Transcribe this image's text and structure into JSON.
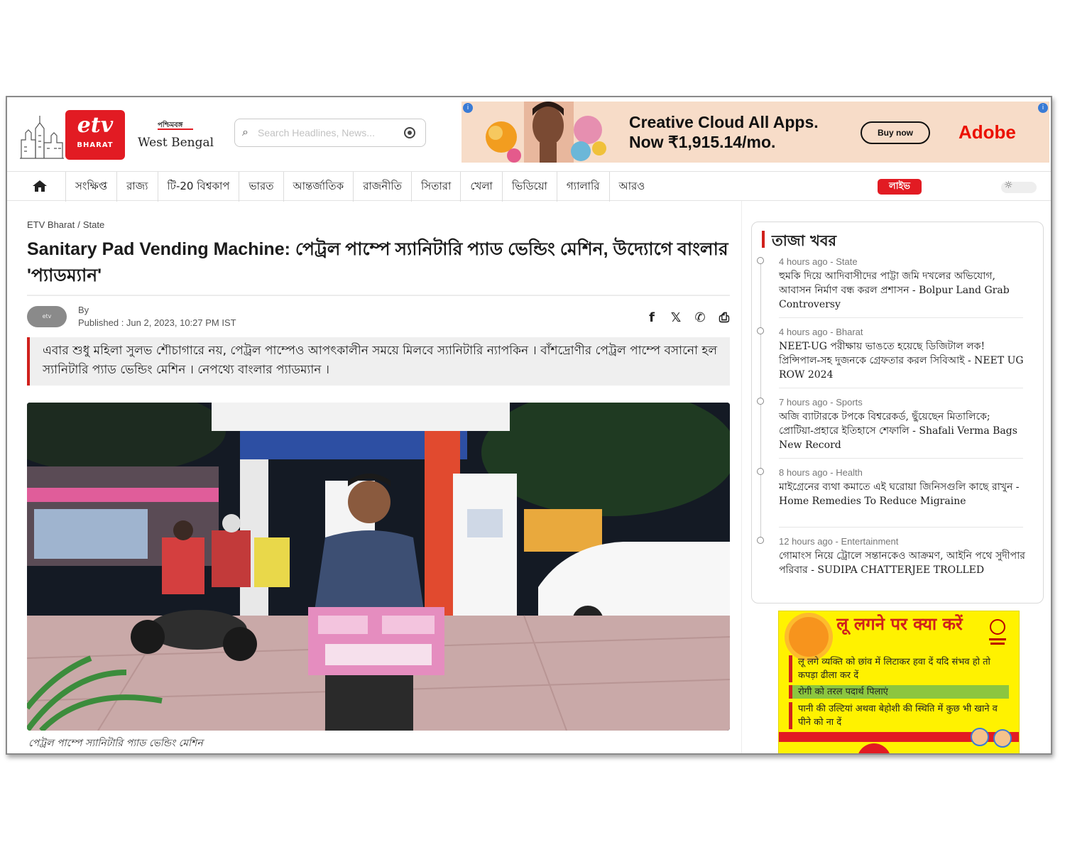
{
  "header": {
    "logo_text": "etv",
    "logo_sub": "BHARAT",
    "region_native": "পশ্চিমবঙ্গ",
    "region": "West Bengal",
    "search_placeholder": "Search Headlines, News..."
  },
  "ad_top": {
    "line1": "Creative Cloud All Apps.",
    "line2": "Now ₹1,915.14/mo.",
    "button": "Buy now",
    "brand": "Adobe"
  },
  "nav": {
    "items": [
      "সংক্ষিপ্ত",
      "রাজ্য",
      "টি-20 বিশ্বকাপ",
      "ভারত",
      "আন্তর্জাতিক",
      "রাজনীতি",
      "সিতারা",
      "খেলা",
      "ভিডিয়ো",
      "গ্যালারি",
      "আরও"
    ],
    "live": "লাইভ"
  },
  "article": {
    "breadcrumb": [
      "ETV Bharat",
      "State"
    ],
    "headline": "Sanitary Pad Vending Machine: পেট্রল পাম্পে স্যানিটারি প্যাড ভেন্ডিং মেশিন, উদ্যোগে বাংলার 'প্যাডম্যান'",
    "by": "By",
    "published": "Published : Jun 2, 2023, 10:27 PM IST",
    "summary": "এবার শুধু মহিলা সুলভ শৌচাগারে নয়, পেট্রল পাম্পেও আপৎকালীন সময়ে মিলবে স্যানিটারি ন্যাপকিন । বাঁশদ্রোণীর পেট্রল পাম্পে বসানো হল স্যানিটারি প্যাড ভেন্ডিং মেশিন । নেপথ্যে বাংলার প্যাডম্যান ।",
    "caption": "পেট্রল পাম্পে স্যানিটারি প্যাড ভেন্ডিং মেশিন"
  },
  "latest": {
    "title": "তাজা খবর",
    "items": [
      {
        "meta": "4 hours ago - State",
        "text": "হুমকি দিয়ে আদিবাসীদের পাট্টা জমি দখলের অভিযোগ, আবাসন নির্মাণ বন্ধ করল প্রশাসন - Bolpur Land Grab Controversy"
      },
      {
        "meta": "4 hours ago - Bharat",
        "text": "NEET-UG পরীক্ষায় ভাঙতে হয়েছে ডিজিটাল লক! প্রিন্সিপাল-সহ দুজনকে গ্রেফতার করল সিবিআই - NEET UG ROW 2024"
      },
      {
        "meta": "7 hours ago - Sports",
        "text": "অজি ব্যাটারকে টপকে বিশ্বরেকর্ড, ছুঁয়েছেন মিতালিকে; প্রোটিয়া-প্রহারে ইতিহাসে শেফালি - Shafali Verma Bags New Record"
      },
      {
        "meta": "8 hours ago - Health",
        "text": "মাইগ্রেনের ব্যথা কমাতে এই ঘরোয়া জিনিসগুলি কাছে রাখুন - Home Remedies To Reduce Migraine"
      },
      {
        "meta": "12 hours ago - Entertainment",
        "text": "গোমাংস নিয়ে ট্রোলে সন্তানকেও আক্রমণ, আইনি পথে সুদীপার পরিবার - SUDIPA CHATTERJEE TROLLED"
      }
    ]
  },
  "health_ad": {
    "title": "लू लगने पर क्या करें",
    "row1": "लू लगे व्यक्ति को छांव में लिटाकर हवा दें यदि संभव हो तो कपड़ा ढीला कर दें",
    "row2": "रोगी को तरल पदार्थ पिलाएं",
    "row3": "पानी की उल्टियां अथवा बेहोशी की स्थिति में कुछ भी खाने व पीने को ना दें"
  }
}
